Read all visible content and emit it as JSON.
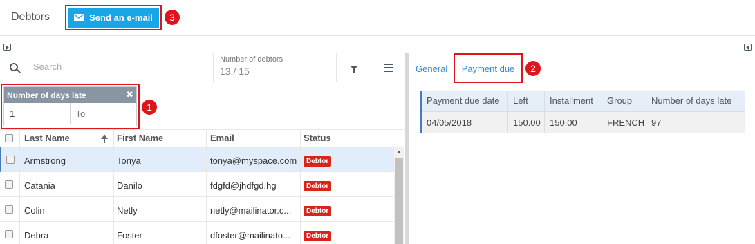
{
  "header": {
    "title": "Debtors",
    "send_email_label": "Send an e-mail",
    "callout_send": "3"
  },
  "search": {
    "placeholder": "Search",
    "count_label": "Number of debtors",
    "count_value": "13 / 15"
  },
  "filter": {
    "title": "Number of days late",
    "from_value": "1",
    "to_placeholder": "To",
    "callout": "1"
  },
  "grid": {
    "columns": [
      "Last Name",
      "First Name",
      "Email",
      "Status"
    ],
    "rows": [
      {
        "last": "Armstrong",
        "first": "Tonya",
        "email": "tonya@myspace.com",
        "status": "Debtor"
      },
      {
        "last": "Catania",
        "first": "Danilo",
        "email": "fdgfd@jhdfgd.hg",
        "status": "Debtor"
      },
      {
        "last": "Colin",
        "first": "Netly",
        "email": "netly@mailinator.c...",
        "status": "Debtor"
      },
      {
        "last": "Debra",
        "first": "Foster",
        "email": "dfoster@mailinato...",
        "status": "Debtor"
      }
    ]
  },
  "detail": {
    "tabs": [
      {
        "label": "General"
      },
      {
        "label": "Payment due"
      }
    ],
    "callout_tab": "2",
    "payment": {
      "columns": [
        "Payment due date",
        "Left",
        "Installment",
        "Group",
        "Number of days late"
      ],
      "rows": [
        {
          "date": "04/05/2018",
          "left": "150.00",
          "installment": "150.00",
          "group": "FRENCH",
          "days_late": "97"
        }
      ]
    }
  },
  "colors": {
    "accent": "#19a6e6",
    "callout": "#e0151b",
    "status_debtor": "#d9241b",
    "link": "#2a8ad4"
  }
}
